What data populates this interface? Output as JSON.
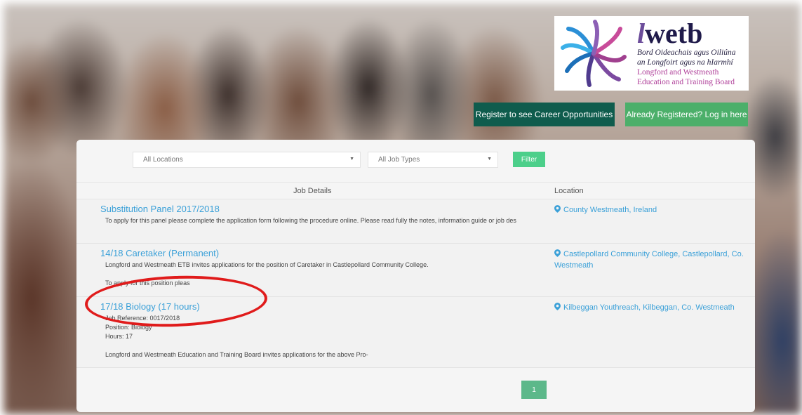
{
  "header": {
    "logo": {
      "brand_prefix": "l",
      "brand_suffix": "wetb",
      "irish_line_1": "Bord Oideachais agus Oiliúna",
      "irish_line_2": "an Longfoirt agus na hIarmhí",
      "english_line_1": "Longford and Westmeath",
      "english_line_2": "Education and Training Board"
    },
    "register_button": "Register to see Career Opportunities",
    "login_button": "Already Registered? Log in here"
  },
  "filters": {
    "location_select": "All Locations",
    "job_type_select": "All Job Types",
    "filter_button": "Filter"
  },
  "table": {
    "col_job": "Job Details",
    "col_location": "Location",
    "rows": [
      {
        "title": "Substitution Panel 2017/2018",
        "desc": [
          "To apply for this panel please complete the application form following the procedure online. Please read fully the notes, information guide or job des"
        ],
        "location": "County Westmeath, Ireland"
      },
      {
        "title": "14/18 Caretaker (Permanent)",
        "desc": [
          "Longford and Westmeath ETB invites applications for the position of Caretaker in Castlepollard Community College.",
          "",
          "To apply for this position pleas"
        ],
        "location": "Castlepollard Community College, Castlepollard, Co. Westmeath"
      },
      {
        "title": "17/18 Biology (17 hours)",
        "desc": [
          "Job Reference: 0017/2018",
          "Position: Biology",
          "Hours: 17",
          "",
          "Longford and Westmeath Education and Training Board invites applications for the above Pro-"
        ],
        "location": "Kilbeggan Youthreach, Kilbeggan, Co. Westmeath"
      }
    ]
  },
  "pagination": {
    "current_page": "1"
  },
  "colors": {
    "link": "#3aa0d8",
    "register_bg": "#0f5c4d",
    "login_bg": "#4caf6a",
    "filter_bg": "#4ccf8a",
    "annotation": "#e01b1b"
  }
}
